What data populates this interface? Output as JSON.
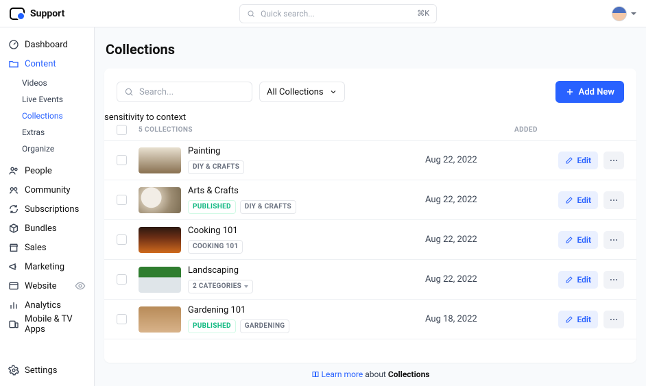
{
  "brand": {
    "title": "Support"
  },
  "search": {
    "placeholder": "Quick search...",
    "shortcut": "⌘K"
  },
  "colors": {
    "accent": "#2962ff",
    "published": "#10b981"
  },
  "sidebar": {
    "items": [
      {
        "label": "Dashboard"
      },
      {
        "label": "Content",
        "active": true,
        "children": [
          {
            "label": "Videos"
          },
          {
            "label": "Live Events"
          },
          {
            "label": "Collections",
            "active": true
          },
          {
            "label": "Extras"
          },
          {
            "label": "Organize"
          }
        ]
      },
      {
        "label": "People"
      },
      {
        "label": "Community"
      },
      {
        "label": "Subscriptions"
      },
      {
        "label": "Bundles"
      },
      {
        "label": "Sales"
      },
      {
        "label": "Marketing"
      },
      {
        "label": "Website"
      },
      {
        "label": "Analytics"
      },
      {
        "label": "Mobile & TV Apps"
      }
    ],
    "footer": {
      "settings": "Settings"
    }
  },
  "page": {
    "title": "Collections"
  },
  "toolbar": {
    "search_placeholder": "Search...",
    "filter_label": "All Collections",
    "add_new_label": "Add New"
  },
  "table": {
    "count_label": "5 COLLECTIONS",
    "added_header": "ADDED",
    "rows": [
      {
        "title": "Painting",
        "tags": [
          {
            "text": "DIY & CRAFTS"
          }
        ],
        "added": "Aug 22, 2022",
        "edit": "Edit"
      },
      {
        "title": "Arts & Crafts",
        "tags": [
          {
            "text": "PUBLISHED",
            "kind": "published"
          },
          {
            "text": "DIY & CRAFTS"
          }
        ],
        "added": "Aug 22, 2022",
        "edit": "Edit"
      },
      {
        "title": "Cooking 101",
        "tags": [
          {
            "text": "COOKING 101"
          }
        ],
        "added": "Aug 22, 2022",
        "edit": "Edit"
      },
      {
        "title": "Landscaping",
        "tags": [
          {
            "text": "2 CATEGORIES",
            "dropdown": true
          }
        ],
        "added": "Aug 22, 2022",
        "edit": "Edit"
      },
      {
        "title": "Gardening 101",
        "tags": [
          {
            "text": "PUBLISHED",
            "kind": "published"
          },
          {
            "text": "GARDENING"
          }
        ],
        "added": "Aug 18, 2022",
        "edit": "Edit"
      }
    ]
  },
  "footer": {
    "learn_more": "Learn more",
    "about": " about ",
    "subject": "Collections"
  }
}
